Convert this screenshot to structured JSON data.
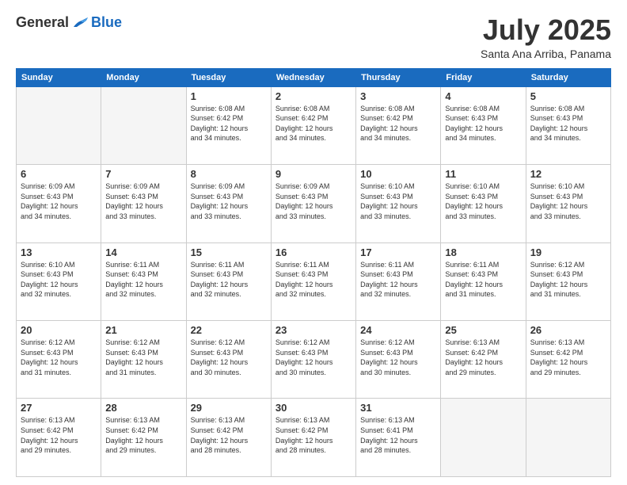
{
  "header": {
    "logo_general": "General",
    "logo_blue": "Blue",
    "month_title": "July 2025",
    "location": "Santa Ana Arriba, Panama"
  },
  "weekdays": [
    "Sunday",
    "Monday",
    "Tuesday",
    "Wednesday",
    "Thursday",
    "Friday",
    "Saturday"
  ],
  "weeks": [
    [
      {
        "day": "",
        "info": ""
      },
      {
        "day": "",
        "info": ""
      },
      {
        "day": "1",
        "info": "Sunrise: 6:08 AM\nSunset: 6:42 PM\nDaylight: 12 hours\nand 34 minutes."
      },
      {
        "day": "2",
        "info": "Sunrise: 6:08 AM\nSunset: 6:42 PM\nDaylight: 12 hours\nand 34 minutes."
      },
      {
        "day": "3",
        "info": "Sunrise: 6:08 AM\nSunset: 6:42 PM\nDaylight: 12 hours\nand 34 minutes."
      },
      {
        "day": "4",
        "info": "Sunrise: 6:08 AM\nSunset: 6:43 PM\nDaylight: 12 hours\nand 34 minutes."
      },
      {
        "day": "5",
        "info": "Sunrise: 6:08 AM\nSunset: 6:43 PM\nDaylight: 12 hours\nand 34 minutes."
      }
    ],
    [
      {
        "day": "6",
        "info": "Sunrise: 6:09 AM\nSunset: 6:43 PM\nDaylight: 12 hours\nand 34 minutes."
      },
      {
        "day": "7",
        "info": "Sunrise: 6:09 AM\nSunset: 6:43 PM\nDaylight: 12 hours\nand 33 minutes."
      },
      {
        "day": "8",
        "info": "Sunrise: 6:09 AM\nSunset: 6:43 PM\nDaylight: 12 hours\nand 33 minutes."
      },
      {
        "day": "9",
        "info": "Sunrise: 6:09 AM\nSunset: 6:43 PM\nDaylight: 12 hours\nand 33 minutes."
      },
      {
        "day": "10",
        "info": "Sunrise: 6:10 AM\nSunset: 6:43 PM\nDaylight: 12 hours\nand 33 minutes."
      },
      {
        "day": "11",
        "info": "Sunrise: 6:10 AM\nSunset: 6:43 PM\nDaylight: 12 hours\nand 33 minutes."
      },
      {
        "day": "12",
        "info": "Sunrise: 6:10 AM\nSunset: 6:43 PM\nDaylight: 12 hours\nand 33 minutes."
      }
    ],
    [
      {
        "day": "13",
        "info": "Sunrise: 6:10 AM\nSunset: 6:43 PM\nDaylight: 12 hours\nand 32 minutes."
      },
      {
        "day": "14",
        "info": "Sunrise: 6:11 AM\nSunset: 6:43 PM\nDaylight: 12 hours\nand 32 minutes."
      },
      {
        "day": "15",
        "info": "Sunrise: 6:11 AM\nSunset: 6:43 PM\nDaylight: 12 hours\nand 32 minutes."
      },
      {
        "day": "16",
        "info": "Sunrise: 6:11 AM\nSunset: 6:43 PM\nDaylight: 12 hours\nand 32 minutes."
      },
      {
        "day": "17",
        "info": "Sunrise: 6:11 AM\nSunset: 6:43 PM\nDaylight: 12 hours\nand 32 minutes."
      },
      {
        "day": "18",
        "info": "Sunrise: 6:11 AM\nSunset: 6:43 PM\nDaylight: 12 hours\nand 31 minutes."
      },
      {
        "day": "19",
        "info": "Sunrise: 6:12 AM\nSunset: 6:43 PM\nDaylight: 12 hours\nand 31 minutes."
      }
    ],
    [
      {
        "day": "20",
        "info": "Sunrise: 6:12 AM\nSunset: 6:43 PM\nDaylight: 12 hours\nand 31 minutes."
      },
      {
        "day": "21",
        "info": "Sunrise: 6:12 AM\nSunset: 6:43 PM\nDaylight: 12 hours\nand 31 minutes."
      },
      {
        "day": "22",
        "info": "Sunrise: 6:12 AM\nSunset: 6:43 PM\nDaylight: 12 hours\nand 30 minutes."
      },
      {
        "day": "23",
        "info": "Sunrise: 6:12 AM\nSunset: 6:43 PM\nDaylight: 12 hours\nand 30 minutes."
      },
      {
        "day": "24",
        "info": "Sunrise: 6:12 AM\nSunset: 6:43 PM\nDaylight: 12 hours\nand 30 minutes."
      },
      {
        "day": "25",
        "info": "Sunrise: 6:13 AM\nSunset: 6:42 PM\nDaylight: 12 hours\nand 29 minutes."
      },
      {
        "day": "26",
        "info": "Sunrise: 6:13 AM\nSunset: 6:42 PM\nDaylight: 12 hours\nand 29 minutes."
      }
    ],
    [
      {
        "day": "27",
        "info": "Sunrise: 6:13 AM\nSunset: 6:42 PM\nDaylight: 12 hours\nand 29 minutes."
      },
      {
        "day": "28",
        "info": "Sunrise: 6:13 AM\nSunset: 6:42 PM\nDaylight: 12 hours\nand 29 minutes."
      },
      {
        "day": "29",
        "info": "Sunrise: 6:13 AM\nSunset: 6:42 PM\nDaylight: 12 hours\nand 28 minutes."
      },
      {
        "day": "30",
        "info": "Sunrise: 6:13 AM\nSunset: 6:42 PM\nDaylight: 12 hours\nand 28 minutes."
      },
      {
        "day": "31",
        "info": "Sunrise: 6:13 AM\nSunset: 6:41 PM\nDaylight: 12 hours\nand 28 minutes."
      },
      {
        "day": "",
        "info": ""
      },
      {
        "day": "",
        "info": ""
      }
    ]
  ]
}
